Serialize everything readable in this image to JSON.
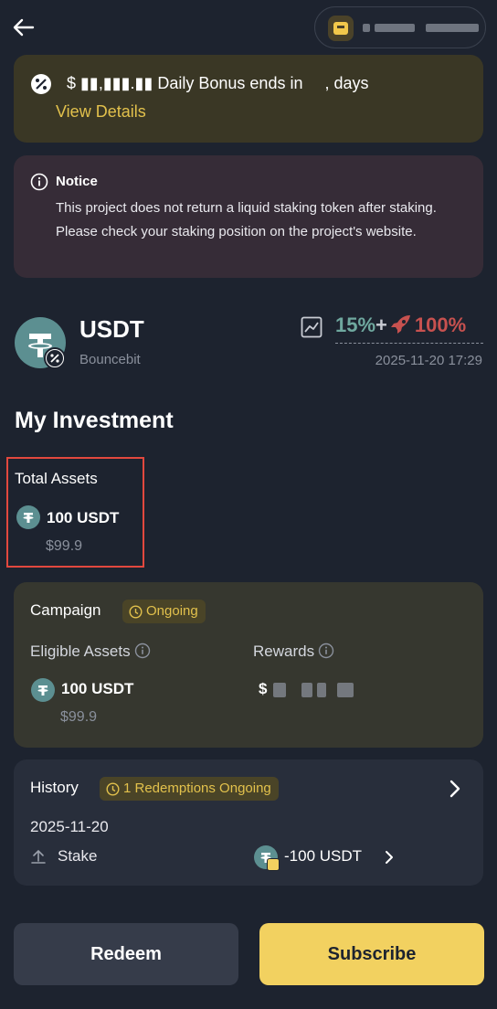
{
  "bonus": {
    "amount_text": "$ ▮▮,▮▮▮.▮▮",
    "message": "Daily Bonus ends in",
    "days_suffix": ", days",
    "view_details": "View Details"
  },
  "notice": {
    "title": "Notice",
    "body": "This project does not return a liquid staking token after staking. Please check your staking position on the project's website."
  },
  "token": {
    "name": "USDT",
    "provider": "Bouncebit",
    "apr_base": "15%",
    "apr_plus": "+",
    "apr_boost": "100%",
    "timestamp": "2025-11-20 17:29"
  },
  "investment": {
    "title": "My Investment",
    "total_label": "Total Assets",
    "total_value": "100 USDT",
    "total_usd": "$99.9"
  },
  "campaign": {
    "title": "Campaign",
    "status": "Ongoing",
    "eligible_label": "Eligible Assets",
    "rewards_label": "Rewards",
    "eligible_value": "100 USDT",
    "eligible_usd": "$99.9",
    "rewards_value": "$"
  },
  "history": {
    "title": "History",
    "status": "1 Redemptions Ongoing",
    "date": "2025-11-20",
    "type": "Stake",
    "amount": "-100 USDT"
  },
  "actions": {
    "redeem": "Redeem",
    "subscribe": "Subscribe"
  },
  "colors": {
    "background": "#1d232f",
    "accent_yellow": "#f2d160",
    "apr_green": "#6fa89f",
    "boost_red": "#c7514f",
    "highlight_box": "#e2483e"
  }
}
